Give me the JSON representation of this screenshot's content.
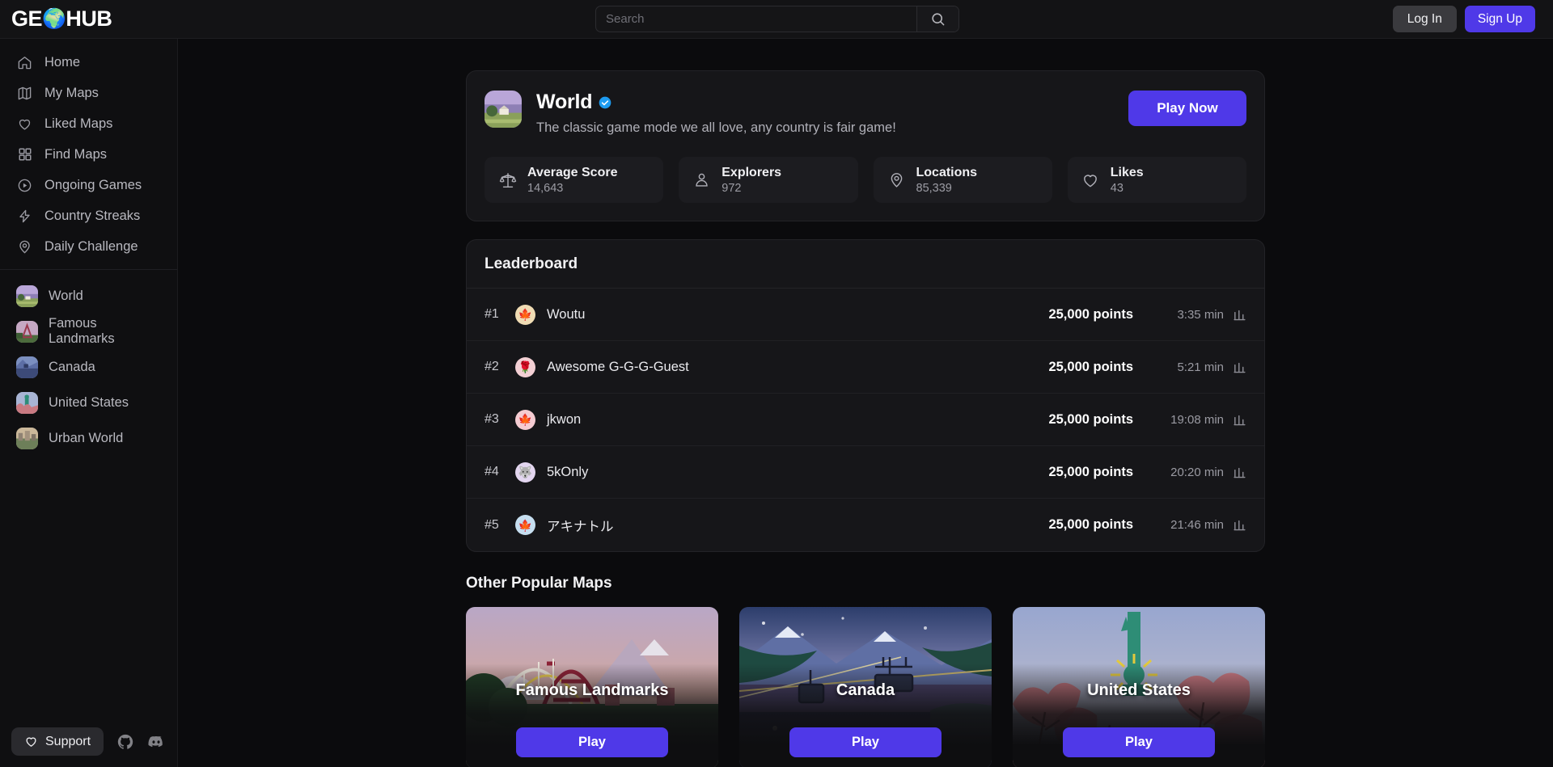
{
  "brand": {
    "part1": "GE",
    "globe_icon": "globe-emoji",
    "part2": "HUB"
  },
  "search": {
    "placeholder": "Search",
    "value": "",
    "icon": "search-icon"
  },
  "auth": {
    "login_label": "Log In",
    "signup_label": "Sign Up"
  },
  "sidebar": {
    "nav": [
      {
        "label": "Home",
        "icon": "home-icon"
      },
      {
        "label": "My Maps",
        "icon": "map-icon"
      },
      {
        "label": "Liked Maps",
        "icon": "heart-icon"
      },
      {
        "label": "Find Maps",
        "icon": "grid-icon"
      },
      {
        "label": "Ongoing Games",
        "icon": "play-circle-icon"
      },
      {
        "label": "Country Streaks",
        "icon": "lightning-icon"
      },
      {
        "label": "Daily Challenge",
        "icon": "location-pin-icon"
      }
    ],
    "maps": [
      {
        "label": "World",
        "thumb": "world-thumb"
      },
      {
        "label": "Famous Landmarks",
        "thumb": "landmarks-thumb"
      },
      {
        "label": "Canada",
        "thumb": "canada-thumb"
      },
      {
        "label": "United States",
        "thumb": "us-thumb"
      },
      {
        "label": "Urban World",
        "thumb": "urban-thumb"
      }
    ],
    "footer": {
      "support_label": "Support",
      "support_icon": "heart-icon",
      "github_icon": "github-icon",
      "discord_icon": "discord-icon"
    }
  },
  "hero": {
    "thumb": "world-thumb",
    "title": "World",
    "verified_icon": "verified-badge-icon",
    "description": "The classic game mode we all love, any country is fair game!",
    "play_label": "Play Now",
    "accent_color": "#4f39e8",
    "stats": [
      {
        "icon": "scales-icon",
        "label": "Average Score",
        "value": "14,643"
      },
      {
        "icon": "person-icon",
        "label": "Explorers",
        "value": "972"
      },
      {
        "icon": "location-icon",
        "label": "Locations",
        "value": "85,339"
      },
      {
        "icon": "heart-icon",
        "label": "Likes",
        "value": "43"
      }
    ]
  },
  "leaderboard": {
    "title": "Leaderboard",
    "rows": [
      {
        "rank": "#1",
        "avatar": "maple-leaf",
        "avatar_bg": "#f0dcb4",
        "name": "Woutu",
        "points": "25,000 points",
        "time": "3:35 min",
        "chart_icon": "bar-chart-icon"
      },
      {
        "rank": "#2",
        "avatar": "rose",
        "avatar_bg": "#f3cfd4",
        "name": "Awesome G-G-G-Guest",
        "points": "25,000 points",
        "time": "5:21 min",
        "chart_icon": "bar-chart-icon"
      },
      {
        "rank": "#3",
        "avatar": "maple-leaf",
        "avatar_bg": "#f5ccd2",
        "name": "jkwon",
        "points": "25,000 points",
        "time": "19:08 min",
        "chart_icon": "bar-chart-icon"
      },
      {
        "rank": "#4",
        "avatar": "wolf",
        "avatar_bg": "#e3d6f0",
        "name": "5kOnly",
        "points": "25,000 points",
        "time": "20:20 min",
        "chart_icon": "bar-chart-icon"
      },
      {
        "rank": "#5",
        "avatar": "maple-leaf",
        "avatar_bg": "#c6def0",
        "name": "アキナトル",
        "points": "25,000 points",
        "time": "21:46 min",
        "chart_icon": "bar-chart-icon"
      }
    ]
  },
  "other_maps": {
    "title": "Other Popular Maps",
    "cards": [
      {
        "name": "Famous Landmarks",
        "play_label": "Play",
        "art": "bridge-mountain"
      },
      {
        "name": "Canada",
        "play_label": "Play",
        "art": "skilift-lake"
      },
      {
        "name": "United States",
        "play_label": "Play",
        "art": "liberty-autumn"
      }
    ]
  }
}
